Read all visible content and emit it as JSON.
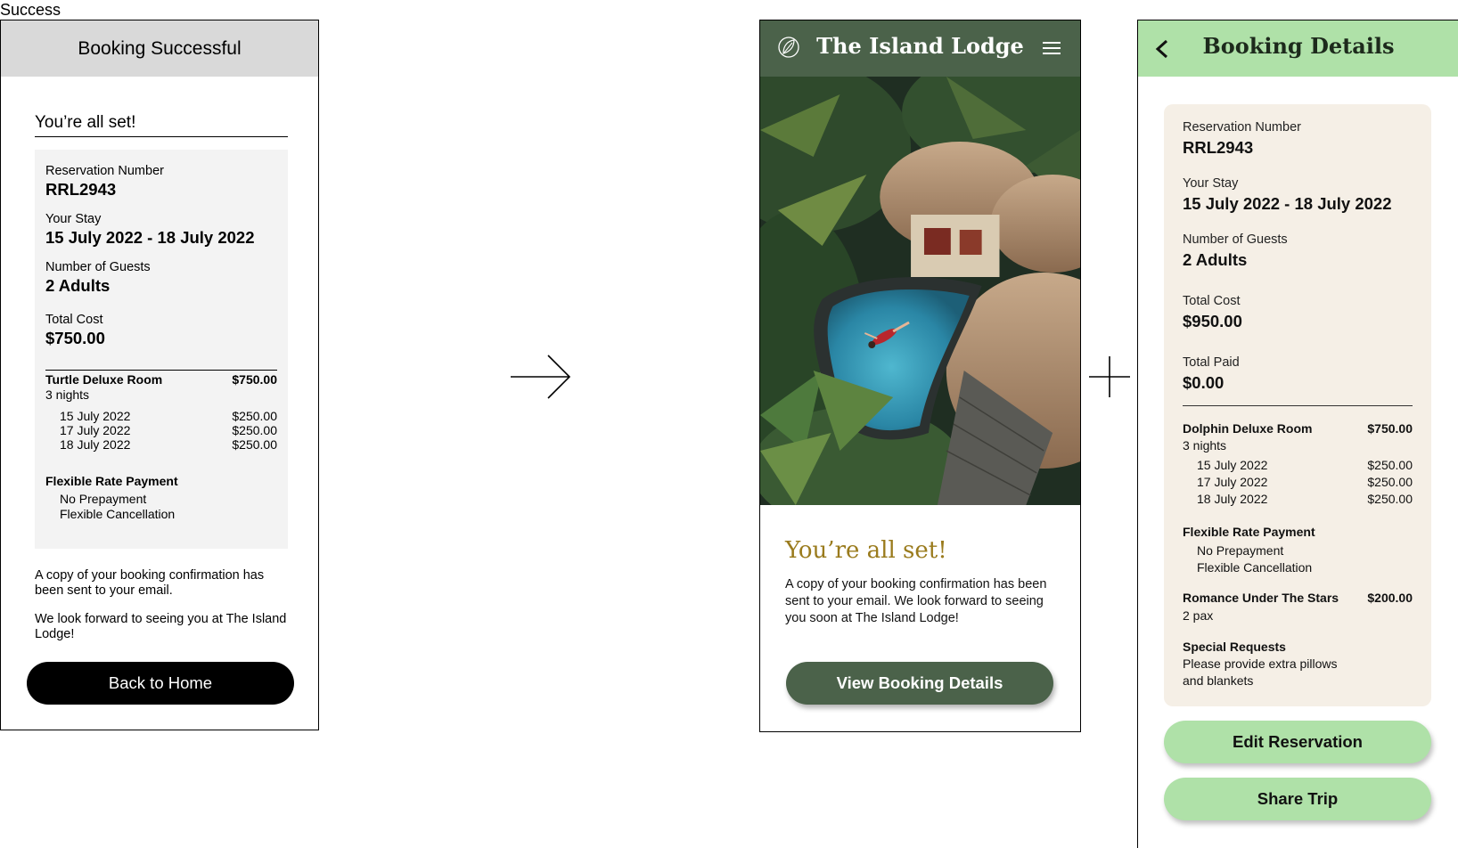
{
  "page_label": "Success",
  "wireframe": {
    "header": "Booking Successful",
    "heading": "You’re all set!",
    "reservation_label": "Reservation Number",
    "reservation_value": "RRL2943",
    "stay_label": "Your Stay",
    "stay_value": "15 July 2022 - 18 July 2022",
    "guests_label": "Number of Guests",
    "guests_value": "2 Adults",
    "cost_label": "Total Cost",
    "cost_value": "$750.00",
    "room": {
      "name": "Turtle Deluxe Room",
      "price": "$750.00",
      "nights": "3 nights"
    },
    "nights": [
      {
        "date": "15 July 2022",
        "price": "$250.00"
      },
      {
        "date": "17 July 2022",
        "price": "$250.00"
      },
      {
        "date": "18 July 2022",
        "price": "$250.00"
      }
    ],
    "rate_title": "Flexible Rate Payment",
    "rate_items": [
      "No Prepayment",
      "Flexible Cancellation"
    ],
    "para1": "A copy of your booking confirmation has been sent to your email.",
    "para2": "We look forward to seeing you at The Island Lodge!",
    "button": "Back to Home"
  },
  "hifi": {
    "brand": "The Island Lodge",
    "title": "You’re all set!",
    "message": "A copy of your booking confirmation has been sent to your email. We look forward to seeing you soon at The Island Lodge!",
    "button": "View Booking Details",
    "colors": {
      "bar": "#4b624a",
      "accent": "#9a7b1d"
    }
  },
  "details": {
    "title": "Booking Details",
    "reservation_label": "Reservation Number",
    "reservation_value": "RRL2943",
    "stay_label": "Your Stay",
    "stay_value": "15 July 2022 - 18 July 2022",
    "guests_label": "Number of Guests",
    "guests_value": "2 Adults",
    "cost_label": "Total Cost",
    "cost_value": "$950.00",
    "paid_label": "Total Paid",
    "paid_value": "$0.00",
    "room": {
      "name": "Dolphin Deluxe Room",
      "price": "$750.00",
      "nights": "3 nights"
    },
    "nights": [
      {
        "date": "15 July 2022",
        "price": "$250.00"
      },
      {
        "date": "17 July 2022",
        "price": "$250.00"
      },
      {
        "date": "18 July 2022",
        "price": "$250.00"
      }
    ],
    "rate_title": "Flexible Rate Payment",
    "rate_items": [
      "No Prepayment",
      "Flexible Cancellation"
    ],
    "addon": {
      "name": "Romance Under The Stars",
      "price": "$200.00",
      "qty": "2 pax"
    },
    "requests_title": "Special Requests",
    "requests_line1": "Please provide extra pillows",
    "requests_line2": "and blankets",
    "edit_button": "Edit Reservation",
    "share_button": "Share Trip",
    "colors": {
      "bar": "#afe1a8",
      "card": "#f5efe6"
    }
  }
}
